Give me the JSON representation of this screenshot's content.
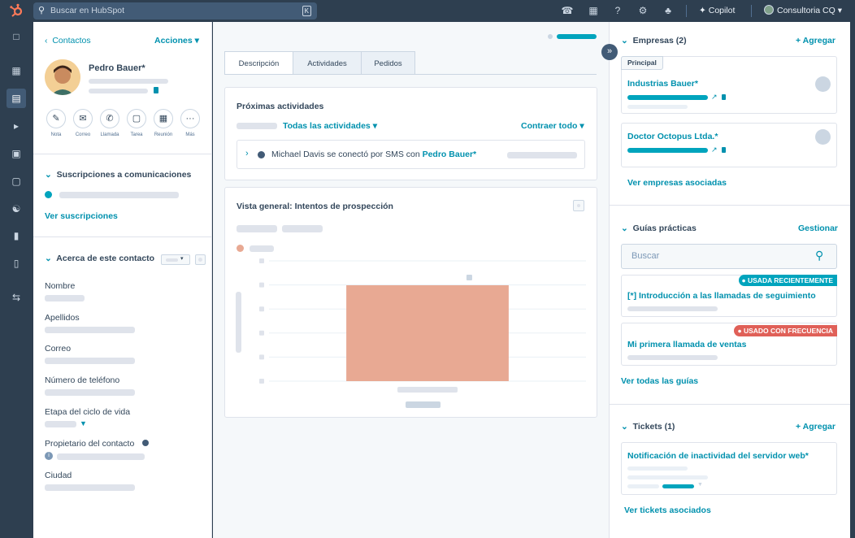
{
  "topbar": {
    "search_placeholder": "Buscar en HubSpot",
    "search_shortcut": "K",
    "copilot_label": "Copilot",
    "account_label": "Consultoria CQ"
  },
  "contact": {
    "back_label": "Contactos",
    "actions_label": "Acciones",
    "name": "Pedro Bauer*",
    "action_buttons": [
      "Nota",
      "Correo",
      "Llamada",
      "Tarea",
      "Reunión",
      "Más"
    ]
  },
  "subscriptions": {
    "title": "Suscripciones a comunicaciones",
    "link": "Ver suscripciones"
  },
  "about": {
    "title": "Acerca de este contacto",
    "fields": [
      "Nombre",
      "Apellidos",
      "Correo",
      "Número de teléfono",
      "Etapa del ciclo de vida",
      "Propietario del contacto",
      "Ciudad"
    ]
  },
  "tabs": [
    "Descripción",
    "Actividades",
    "Pedidos"
  ],
  "upcoming": {
    "title": "Próximas actividades",
    "filter": "Todas las actividades",
    "collapse": "Contraer todo",
    "activity_prefix": "Michael Davis se conectó por SMS con",
    "activity_contact": "Pedro Bauer*"
  },
  "overview": {
    "title": "Vista general: Intentos de prospección"
  },
  "chart_data": {
    "type": "bar",
    "title": "",
    "xlabel": "",
    "ylabel": "",
    "categories": [
      ""
    ],
    "series": [
      {
        "values": [
          1
        ]
      }
    ],
    "colors": [
      "#e8a993"
    ]
  },
  "companies": {
    "title": "Empresas (2)",
    "add_label": "Agregar",
    "primary_tag": "Principal",
    "items": [
      "Industrias Bauer*",
      "Doctor Octopus Ltda.*"
    ],
    "link": "Ver empresas asociadas"
  },
  "guides": {
    "title": "Guías prácticas",
    "manage": "Gestionar",
    "search_placeholder": "Buscar",
    "items": [
      {
        "badge": "USADA RECIENTEMENTE",
        "title": "[*] Introducción a las llamadas de seguimiento"
      },
      {
        "badge": "USADO CON FRECUENCIA",
        "title": "Mi primera llamada de ventas"
      }
    ],
    "link": "Ver todas las guías"
  },
  "tickets": {
    "title": "Tickets (1)",
    "add_label": "Agregar",
    "item": "Notificación de inactividad del servidor web*",
    "link": "Ver tickets asociados"
  },
  "colors": {
    "accent": "#0091ae",
    "dark_nav": "#2e3f50",
    "bar": "#e8a993",
    "badge_teal": "#00a4bd",
    "badge_red": "#e06058"
  }
}
